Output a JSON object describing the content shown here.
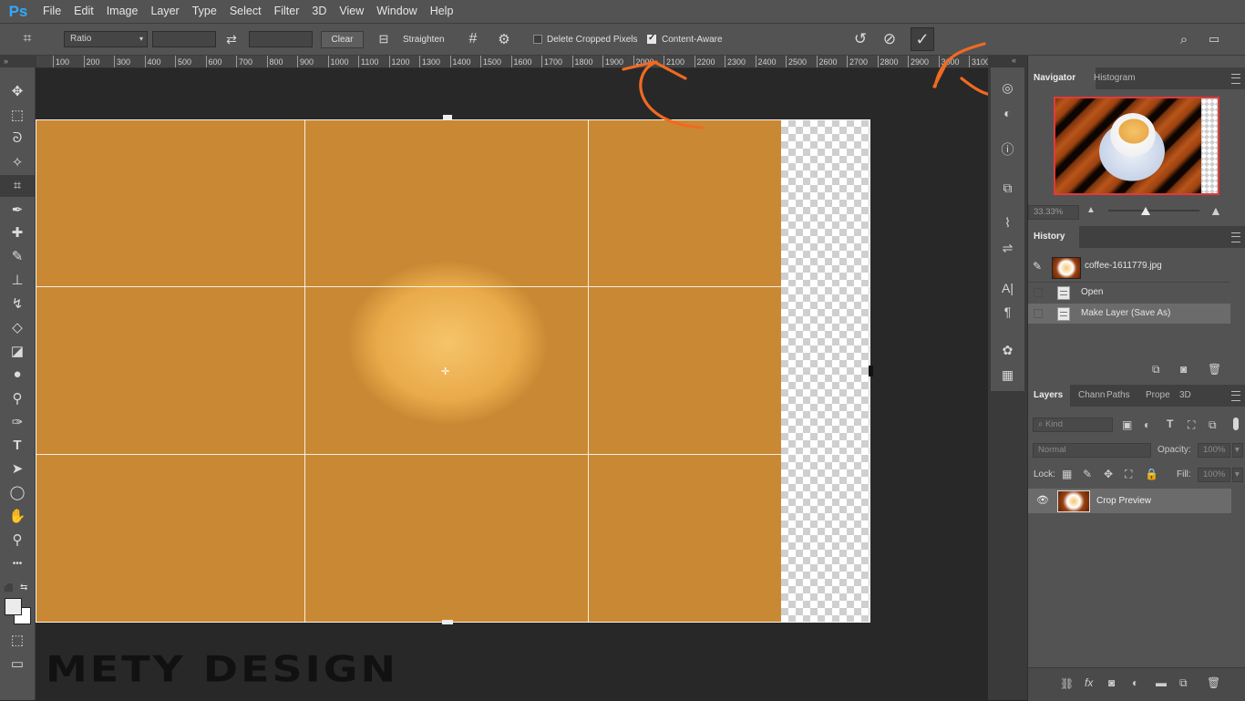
{
  "app": {
    "logo": "Ps"
  },
  "menu": [
    "File",
    "Edit",
    "Image",
    "Layer",
    "Type",
    "Select",
    "Filter",
    "3D",
    "View",
    "Window",
    "Help"
  ],
  "options": {
    "ratio_select": "Ratio",
    "clear_label": "Clear",
    "straighten_label": "Straighten",
    "delete_cropped_label": "Delete Cropped Pixels",
    "delete_cropped_checked": false,
    "content_aware_label": "Content-Aware",
    "content_aware_checked": true
  },
  "ruler": {
    "ticks": [
      "100",
      "200",
      "300",
      "400",
      "500",
      "600",
      "700",
      "800",
      "900",
      "1000",
      "1100",
      "1200",
      "1300",
      "1400",
      "1500",
      "1600",
      "1700",
      "1800",
      "1900",
      "2000",
      "2100",
      "2200",
      "2300",
      "2400",
      "2500",
      "2600",
      "2700",
      "2800",
      "2900",
      "3000",
      "3100"
    ]
  },
  "tools": [
    "move-icon",
    "marquee-icon",
    "lasso-icon",
    "quick-select-icon",
    "crop-icon",
    "eyedropper-icon",
    "healing-icon",
    "brush-icon",
    "stamp-icon",
    "history-brush-icon",
    "eraser-icon",
    "bucket-icon",
    "blur-icon",
    "dodge-icon",
    "pen-icon",
    "type-icon",
    "path-select-icon",
    "ellipse-icon",
    "hand-icon",
    "zoom-icon",
    "more-icon"
  ],
  "watermark": "METY DESIGN",
  "navigator": {
    "tab": "Navigator",
    "tab2": "Histogram",
    "zoom": "33.33%"
  },
  "history": {
    "tab": "History",
    "snapshot": "coffee-1611779.jpg",
    "states": [
      {
        "label": "Open",
        "selected": false
      },
      {
        "label": "Make Layer (Save As)",
        "selected": true
      }
    ]
  },
  "layers": {
    "tabs": [
      "Layers",
      "Chann",
      "Paths",
      "Prope",
      "3D"
    ],
    "filter_placeholder": "Kind",
    "blend_mode": "Normal",
    "opacity_label": "Opacity:",
    "opacity_value": "100%",
    "lock_label": "Lock:",
    "fill_label": "Fill:",
    "fill_value": "100%",
    "items": [
      {
        "name": "Crop Preview",
        "visible": true
      }
    ]
  },
  "colors": {
    "accent_annotation": "#f06a22",
    "ui_bg": "#535353",
    "canvas_bg": "#282828"
  }
}
